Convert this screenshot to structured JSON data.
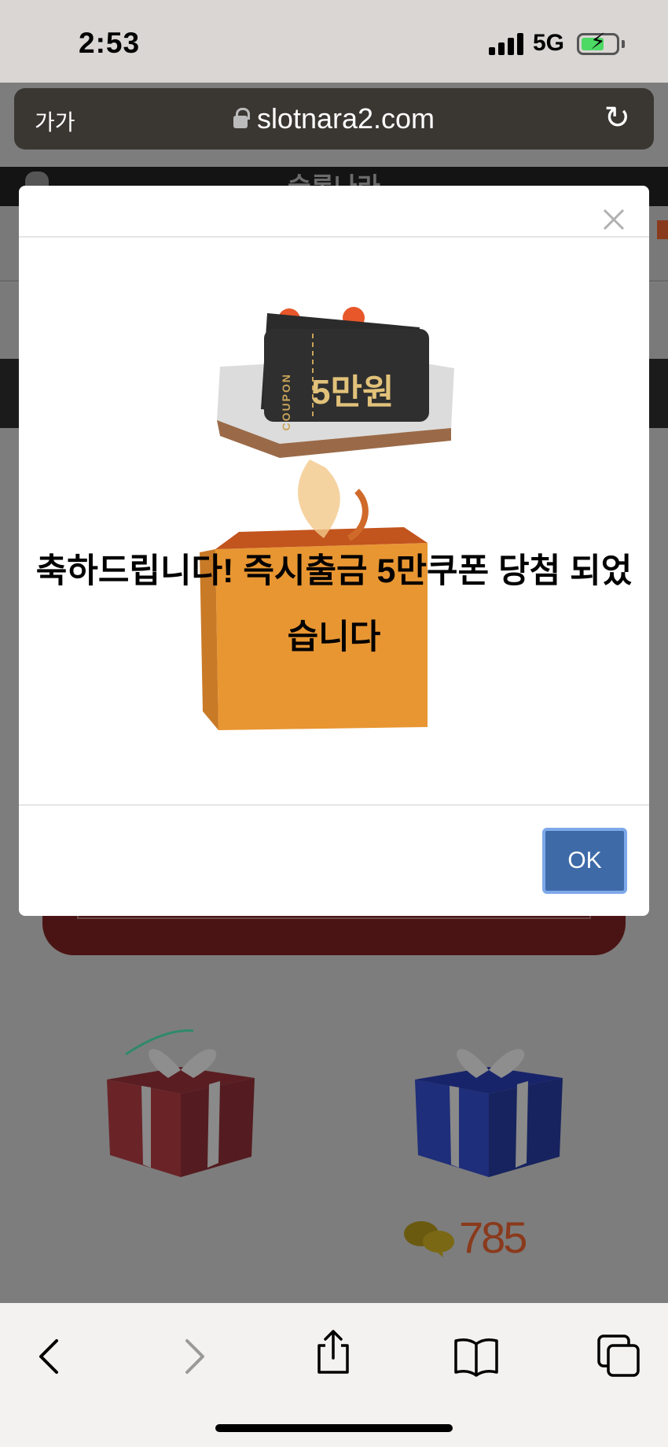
{
  "status_bar": {
    "time": "2:53",
    "network": "5G"
  },
  "browser": {
    "text_size_label": "가가",
    "url": "slotnara2.com"
  },
  "background_page": {
    "site_title": "슬롯나라",
    "comment_count": "785"
  },
  "modal": {
    "coupon_tag": "COUPON",
    "coupon_amount": "5만원",
    "message": "축하드립니다! 즉시출금 5만쿠폰 당첨 되었습니다",
    "ok_label": "OK",
    "close_icon": "close-icon"
  },
  "colors": {
    "ok_button": "#3e6ba8",
    "ok_button_border": "#7ea8ea",
    "overlay": "#7d7d7d",
    "comment_count": "#8a3a1c"
  },
  "toolbar": {
    "icons": [
      "back-icon",
      "forward-icon",
      "share-icon",
      "bookmarks-icon",
      "tabs-icon"
    ]
  }
}
